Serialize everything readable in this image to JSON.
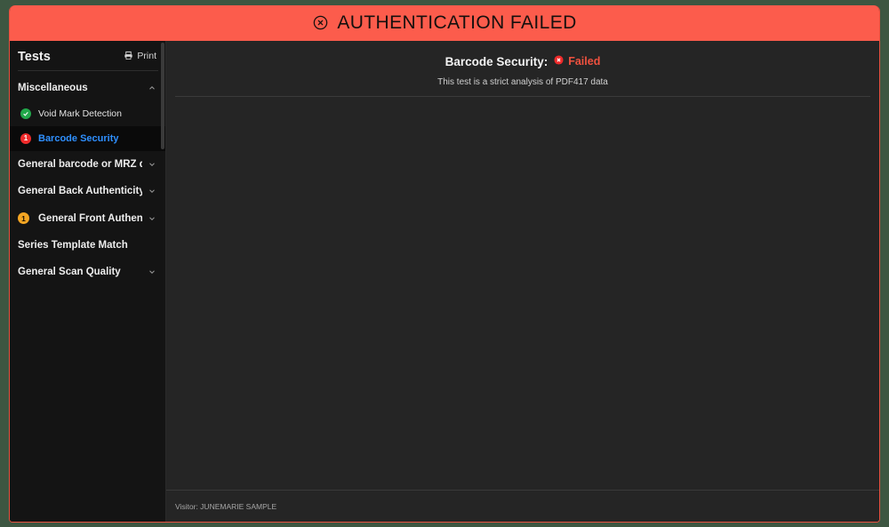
{
  "banner": {
    "icon": "circle-x-icon",
    "text": "AUTHENTICATION FAILED",
    "background_color": "#fc5c4c"
  },
  "sidebar": {
    "title": "Tests",
    "print_button": {
      "label": "Print",
      "icon": "printer-icon"
    },
    "sections": [
      {
        "label": "Miscellaneous",
        "expanded": true,
        "chevron": "chevron-up-icon",
        "badge": null,
        "items": [
          {
            "label": "Void Mark Detection",
            "status": "pass",
            "status_icon": "check-circle-icon",
            "selected": false
          },
          {
            "label": "Barcode Security",
            "status": "fail",
            "badge_count": "1",
            "selected": true
          }
        ]
      },
      {
        "label": "General barcode or MRZ qual...",
        "expanded": false,
        "chevron": "chevron-down-icon",
        "badge": null,
        "items": []
      },
      {
        "label": "General Back Authenticity",
        "expanded": false,
        "chevron": "chevron-down-icon",
        "badge": null,
        "items": []
      },
      {
        "label": "General Front Authenticity",
        "expanded": false,
        "chevron": "chevron-down-icon",
        "badge": {
          "count": "1",
          "color": "#f5a623"
        },
        "items": []
      },
      {
        "label": "Series Template Match",
        "expanded": false,
        "chevron": null,
        "badge": null,
        "items": []
      },
      {
        "label": "General Scan Quality",
        "expanded": false,
        "chevron": "chevron-down-icon",
        "badge": null,
        "items": []
      }
    ]
  },
  "main": {
    "title": "Barcode Security:",
    "status": {
      "label": "Failed",
      "icon": "circle-x-icon",
      "color": "#f0513f"
    },
    "subtitle": "This test is a strict analysis of PDF417 data"
  },
  "footer": {
    "text": "Visitor: JUNEMARIE SAMPLE"
  },
  "colors": {
    "alert": "#fc5c4c",
    "pass": "#21a84a",
    "fail": "#ef2b2b",
    "warn": "#f5a623",
    "link": "#2f90ff"
  }
}
